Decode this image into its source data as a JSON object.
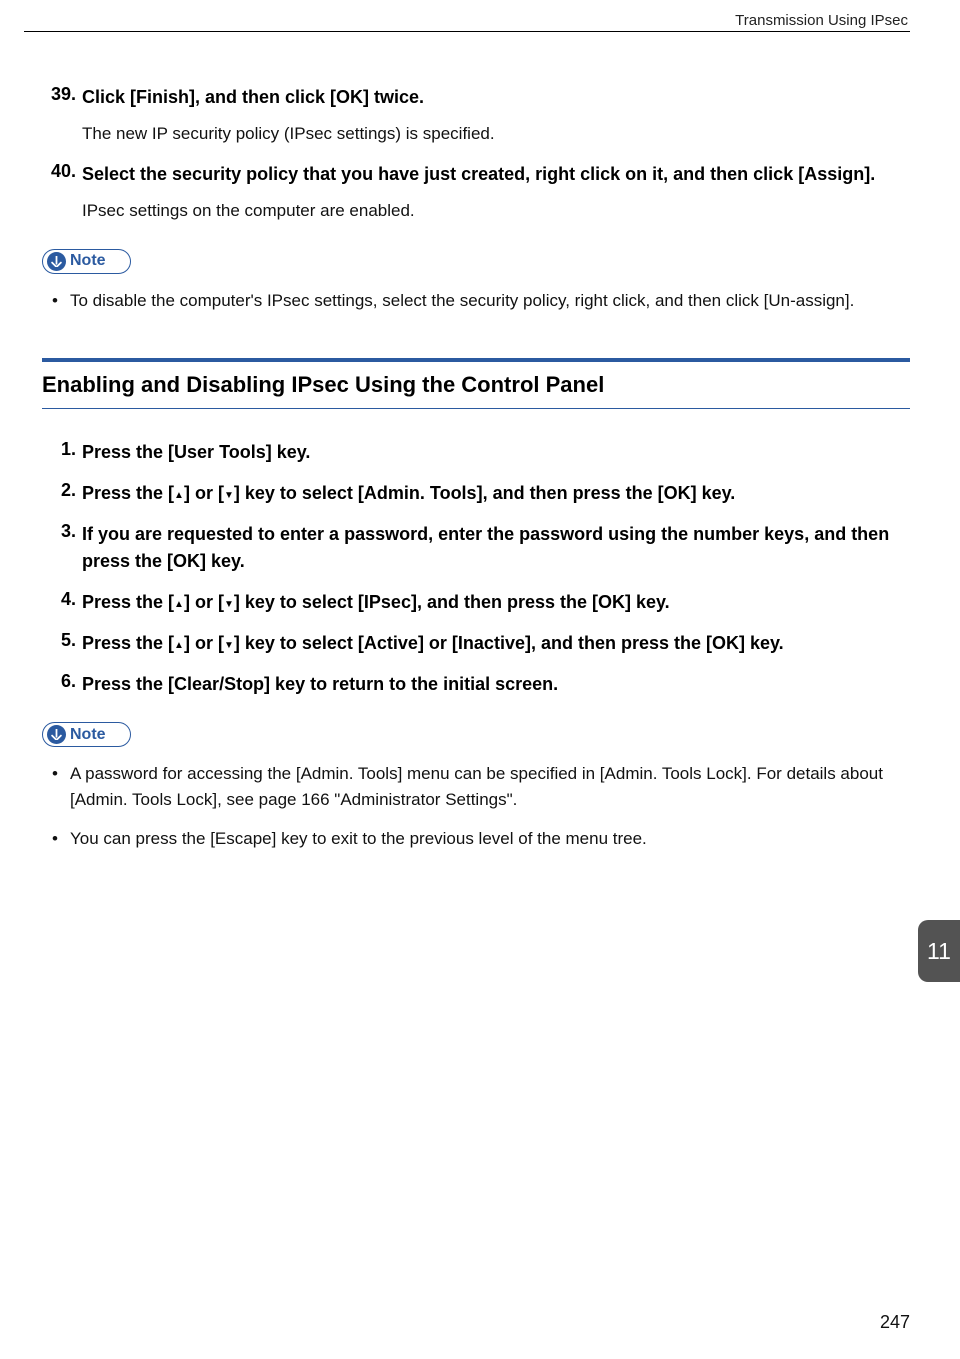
{
  "running_head": "Transmission Using IPsec",
  "steps_a": [
    {
      "n": "39.",
      "bold": "Click [Finish], and then click [OK] twice.",
      "plain": "The new IP security policy (IPsec settings) is specified."
    },
    {
      "n": "40.",
      "bold": "Select the security policy that you have just created, right click on it, and then click [Assign].",
      "plain": "IPsec settings on the computer are enabled."
    }
  ],
  "note_label": "Note",
  "note_a": [
    "To disable the computer's IPsec settings, select the security policy, right click, and then click [Un-assign]."
  ],
  "section_title": "Enabling and Disabling IPsec Using the Control Panel",
  "steps_b": [
    {
      "n": "1.",
      "pre": "Press the [User Tools] key."
    },
    {
      "n": "2.",
      "pre": "Press the [",
      "mid": "] or [",
      "post": "] key to select [Admin. Tools], and then press the [OK] key."
    },
    {
      "n": "3.",
      "pre": "If you are requested to enter a password, enter the password using the number keys, and then press the [OK] key."
    },
    {
      "n": "4.",
      "pre": "Press the [",
      "mid": "] or [",
      "post": "] key to select [IPsec], and then press the [OK] key."
    },
    {
      "n": "5.",
      "pre": "Press the [",
      "mid": "] or [",
      "post": "] key to select [Active] or [Inactive], and then press the [OK] key."
    },
    {
      "n": "6.",
      "pre": "Press the [Clear/Stop] key to return to the initial screen."
    }
  ],
  "note_b": [
    "A password for accessing the [Admin. Tools] menu can be specified in [Admin. Tools Lock]. For details about [Admin. Tools Lock], see page 166 \"Administrator Settings\".",
    "You can press the [Escape] key to exit to the previous level of the menu tree."
  ],
  "tab": "11",
  "page_number": "247",
  "icons": {
    "up": "▲",
    "down": "▼"
  }
}
